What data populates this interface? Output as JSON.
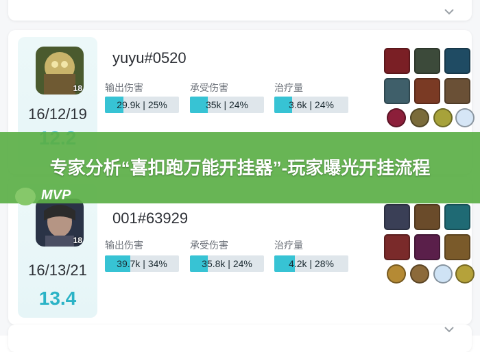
{
  "overlay": {
    "title": "专家分析“喜扣跑万能开挂器”-玩家曝光开挂流程",
    "mvp_label": "MVP"
  },
  "records": [
    {
      "player": "yuyu#0520",
      "level": "18",
      "kda": "16/12/19",
      "score": "12.2",
      "stats": [
        {
          "label": "输出伤害",
          "value": "29.9k | 25%",
          "fill": 0.25
        },
        {
          "label": "承受伤害",
          "value": "35k | 24%",
          "fill": 0.24
        },
        {
          "label": "治疗量",
          "value": "3.6k | 24%",
          "fill": 0.24
        }
      ]
    },
    {
      "player": "001#63929",
      "level": "18",
      "kda": "16/13/21",
      "score": "13.4",
      "stats": [
        {
          "label": "输出伤害",
          "value": "39.7k | 34%",
          "fill": 0.34
        },
        {
          "label": "承受伤害",
          "value": "35.8k | 24%",
          "fill": 0.24
        },
        {
          "label": "治疗量",
          "value": "4.2k | 28%",
          "fill": 0.28
        }
      ]
    }
  ],
  "colors": {
    "accent": "#37c3d4",
    "score": "#2bb3c6",
    "banner": "#5caf48"
  }
}
